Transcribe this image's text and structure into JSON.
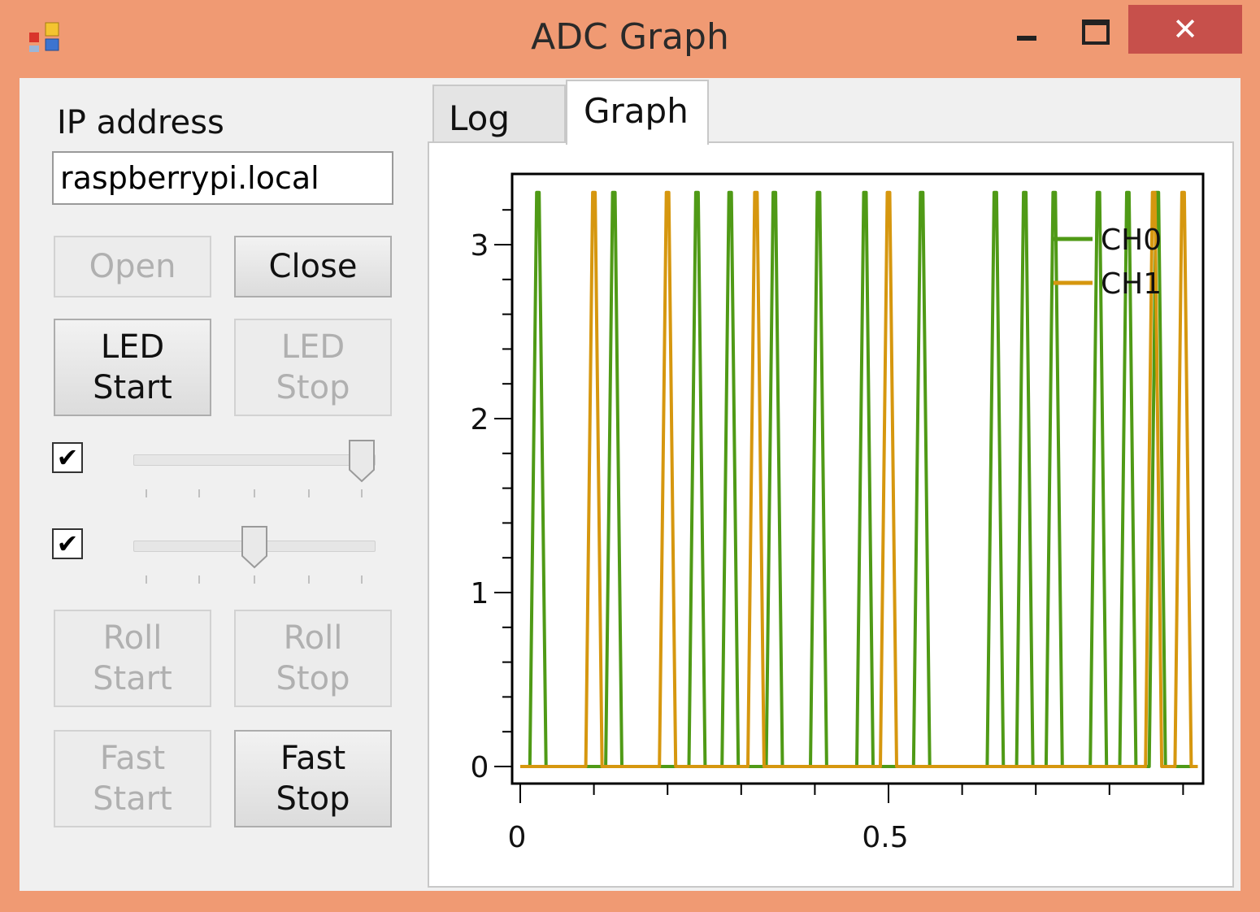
{
  "window": {
    "title": "ADC Graph",
    "close_glyph": "✕"
  },
  "left": {
    "ip_label": "IP address",
    "ip_value": "raspberrypi.local",
    "buttons": {
      "open": "Open",
      "close": "Close",
      "led_start_1": "LED",
      "led_start_2": "Start",
      "led_stop_1": "LED",
      "led_stop_2": "Stop",
      "roll_start_1": "Roll",
      "roll_start_2": "Start",
      "roll_stop_1": "Roll",
      "roll_stop_2": "Stop",
      "fast_start_1": "Fast",
      "fast_start_2": "Start",
      "fast_stop_1": "Fast",
      "fast_stop_2": "Stop"
    },
    "checkbox1": {
      "checked": true,
      "glyph": "✔"
    },
    "checkbox2": {
      "checked": true,
      "glyph": "✔"
    },
    "slider1": {
      "value": 4,
      "min": 0,
      "max": 4
    },
    "slider2": {
      "value": 2,
      "min": 0,
      "max": 4
    }
  },
  "tabs": {
    "log": "Log",
    "graph": "Graph",
    "selected": "Graph"
  },
  "colors": {
    "ch0": "#4f9a16",
    "ch1": "#d6970f",
    "close_bg": "#c7504b",
    "frame": "#f09a73"
  },
  "chart_data": {
    "type": "line",
    "title": "",
    "xlabel": "",
    "ylabel": "",
    "xlim": [
      0,
      0.92
    ],
    "ylim": [
      0,
      3.3
    ],
    "x_ticks": [
      0,
      0.5
    ],
    "y_ticks": [
      0,
      1,
      2,
      3
    ],
    "legend_position": "top-right",
    "series": [
      {
        "name": "CH0",
        "color": "#4f9a16",
        "baseline": 0,
        "spike_height": 3.3,
        "spikes": [
          0.024,
          0.127,
          0.24,
          0.285,
          0.345,
          0.405,
          0.468,
          0.545,
          0.645,
          0.685,
          0.725,
          0.785,
          0.825,
          0.865
        ]
      },
      {
        "name": "CH1",
        "color": "#d6970f",
        "baseline": 0,
        "spike_height": 3.3,
        "spikes": [
          0.1,
          0.2,
          0.32,
          0.5,
          0.86,
          0.9
        ]
      }
    ]
  }
}
